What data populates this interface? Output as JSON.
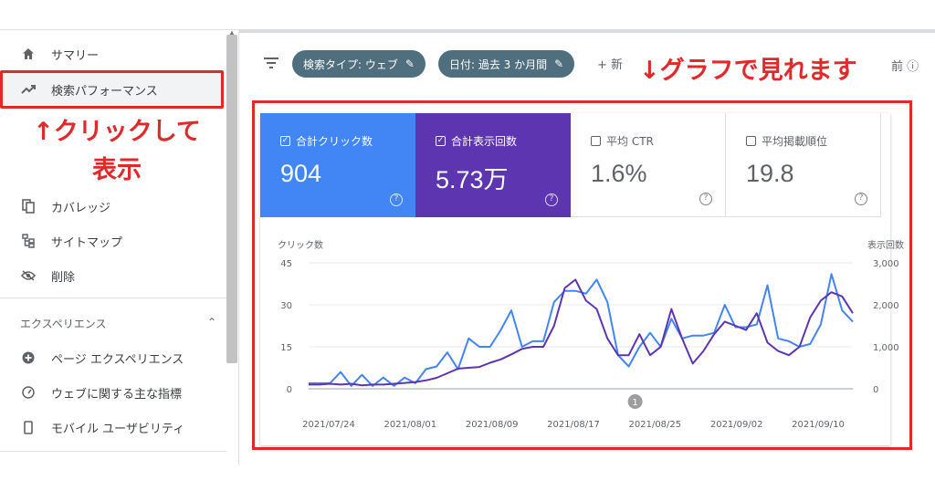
{
  "sidebar": {
    "items": [
      {
        "label": "サマリー",
        "icon": "home-icon"
      },
      {
        "label": "検索パフォーマンス",
        "icon": "trending-up-icon",
        "active": true
      },
      {
        "label": "カバレッジ",
        "icon": "copy-icon"
      },
      {
        "label": "サイトマップ",
        "icon": "sitemap-icon"
      },
      {
        "label": "削除",
        "icon": "eye-off-icon"
      }
    ],
    "section_title": "エクスペリエンス",
    "section_items": [
      {
        "label": "ページ エクスペリエンス",
        "icon": "plus-circle-icon"
      },
      {
        "label": "ウェブに関する主な指標",
        "icon": "gauge-icon"
      },
      {
        "label": "モバイル ユーザビリティ",
        "icon": "phone-icon"
      }
    ]
  },
  "annotations": {
    "left_line1": "↑クリックして",
    "left_line2": "表示",
    "top": "↓グラフで見れます"
  },
  "filters": {
    "chip_search_type": "検索タイプ: ウェブ",
    "chip_date": "日付: 過去 3 か月間",
    "new_label": "+ 新",
    "tail": "前 ⓘ"
  },
  "metrics": [
    {
      "label": "合計クリック数",
      "value": "904",
      "checked": true,
      "color": "#4285f4"
    },
    {
      "label": "合計表示回数",
      "value": "5.73万",
      "checked": true,
      "color": "#5e35b1"
    },
    {
      "label": "平均 CTR",
      "value": "1.6%",
      "checked": false
    },
    {
      "label": "平均掲載順位",
      "value": "19.8",
      "checked": false
    }
  ],
  "chart_data": {
    "type": "line",
    "y_left_label": "クリック数",
    "y_right_label": "表示回数",
    "y_left_ticks": [
      "45",
      "30",
      "15",
      "0"
    ],
    "y_right_ticks": [
      "3,000",
      "2,000",
      "1,000",
      "0"
    ],
    "ylim_left": [
      0,
      45
    ],
    "ylim_right": [
      0,
      3000
    ],
    "x_ticks": [
      "2021/07/24",
      "2021/08/01",
      "2021/08/09",
      "2021/08/17",
      "2021/08/25",
      "2021/09/02",
      "2021/09/10"
    ],
    "annotation_marker": "1",
    "series": [
      {
        "name": "合計クリック数",
        "axis": "left",
        "color": "#4285f4",
        "values": [
          2,
          2,
          2,
          6,
          1,
          5,
          1,
          4,
          1,
          4,
          2,
          7,
          8,
          13,
          7,
          18,
          15,
          15,
          21,
          28,
          15,
          17,
          17,
          31,
          35,
          35,
          34,
          39,
          31,
          12,
          8,
          15,
          20,
          15,
          25,
          18,
          19,
          19,
          20,
          30,
          22,
          22,
          23,
          37,
          18,
          17,
          15,
          16,
          23,
          41,
          28,
          24
        ]
      },
      {
        "name": "合計表示回数",
        "axis": "right",
        "color": "#5e35b1",
        "values": [
          100,
          100,
          120,
          100,
          120,
          80,
          100,
          100,
          120,
          140,
          160,
          200,
          260,
          370,
          480,
          500,
          520,
          620,
          700,
          820,
          950,
          1000,
          1000,
          1500,
          2400,
          2600,
          2100,
          1900,
          1200,
          800,
          800,
          1300,
          800,
          1000,
          1900,
          1200,
          600,
          900,
          1300,
          1600,
          1500,
          1400,
          1800,
          1100,
          900,
          800,
          1000,
          1700,
          2100,
          2300,
          2200,
          1800
        ]
      }
    ]
  }
}
